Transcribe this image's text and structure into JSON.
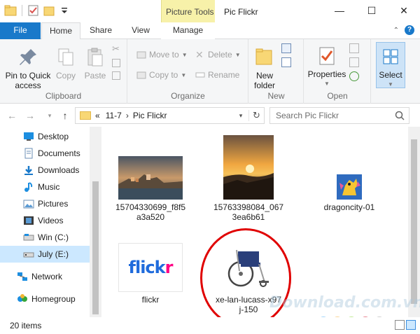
{
  "window": {
    "title": "Pic Flickr",
    "context_tab_header": "Picture Tools",
    "controls": {
      "minimize": "—",
      "maximize": "☐",
      "close": "✕"
    }
  },
  "ribbon_tabs": {
    "file": "File",
    "home": "Home",
    "share": "Share",
    "view": "View",
    "manage": "Manage"
  },
  "ribbon": {
    "clipboard": {
      "label": "Clipboard",
      "pin": "Pin to Quick access",
      "copy": "Copy",
      "paste": "Paste"
    },
    "organize": {
      "label": "Organize",
      "move_to": "Move to",
      "copy_to": "Copy to",
      "delete": "Delete",
      "rename": "Rename"
    },
    "new": {
      "label": "New",
      "new_folder": "New folder"
    },
    "open": {
      "label": "Open",
      "properties": "Properties"
    },
    "select": {
      "label": "Select"
    }
  },
  "address": {
    "crumbs": [
      "«",
      "11-7",
      "Pic Flickr"
    ],
    "search_placeholder": "Search Pic Flickr"
  },
  "nav_pane": {
    "items": [
      {
        "label": "Desktop",
        "icon": "desktop-icon"
      },
      {
        "label": "Documents",
        "icon": "documents-icon"
      },
      {
        "label": "Downloads",
        "icon": "downloads-icon"
      },
      {
        "label": "Music",
        "icon": "music-icon"
      },
      {
        "label": "Pictures",
        "icon": "pictures-icon"
      },
      {
        "label": "Videos",
        "icon": "videos-icon"
      },
      {
        "label": "Win (C:)",
        "icon": "drive-icon"
      },
      {
        "label": "July (E:)",
        "icon": "drive-icon"
      }
    ],
    "network": "Network",
    "homegroup": "Homegroup"
  },
  "files": [
    {
      "name_line1": "15704330699_f8f5",
      "name_line2": "a3a520"
    },
    {
      "name_line1": "15763398084_067",
      "name_line2": "3ea6b61"
    },
    {
      "name_line1": "dragoncity-01",
      "name_line2": ""
    },
    {
      "name_line1": "flickr",
      "name_line2": ""
    },
    {
      "name_line1": "xe-lan-lucass-x97",
      "name_line2": "j-150"
    }
  ],
  "flickr_logo_text": {
    "part1": "flick",
    "part2": "r"
  },
  "status": {
    "count": "20 items"
  },
  "watermark": "Download.com.vn",
  "colors": {
    "accent": "#1979ca",
    "selection": "#cce8ff",
    "context_tab": "#f7f1a9",
    "highlight_circle": "#e00000"
  }
}
